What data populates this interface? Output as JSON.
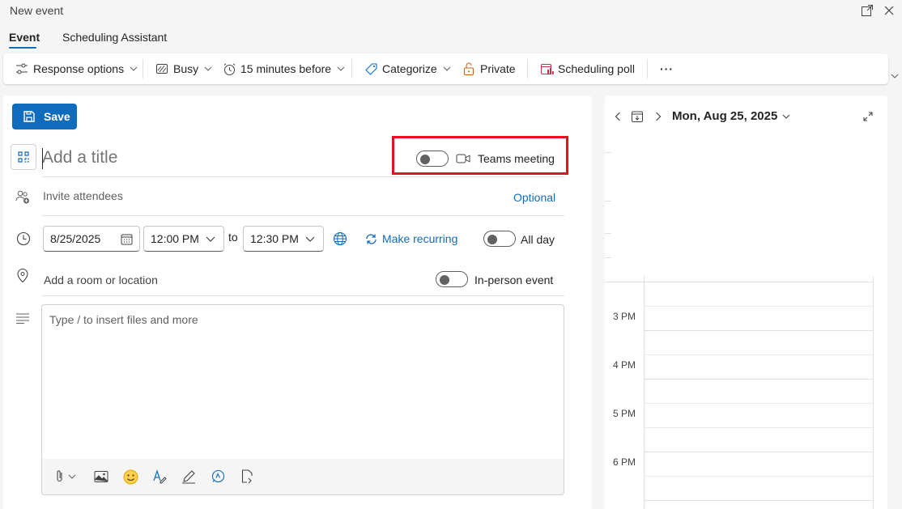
{
  "window": {
    "title": "New event",
    "popout_icon": "popout-icon",
    "close_icon": "close-icon"
  },
  "tabs": [
    {
      "label": "Event",
      "active": true
    },
    {
      "label": "Scheduling Assistant",
      "active": false
    }
  ],
  "ribbon": {
    "response_options": "Response options",
    "busy": "Busy",
    "reminder": "15 minutes before",
    "categorize": "Categorize",
    "private": "Private",
    "scheduling_poll": "Scheduling poll",
    "more": "···"
  },
  "form": {
    "save_label": "Save",
    "title_placeholder": "Add a title",
    "teams_label": "Teams meeting",
    "teams_enabled": false,
    "attendees_placeholder": "Invite attendees",
    "optional_label": "Optional",
    "start_date": "8/25/2025",
    "start_time": "12:00 PM",
    "to_label": "to",
    "end_time": "12:30 PM",
    "make_recurring": "Make recurring",
    "all_day_label": "All day",
    "all_day_enabled": false,
    "location_placeholder": "Add a room or location",
    "in_person_label": "In-person event",
    "in_person_enabled": false,
    "body_placeholder": "Type / to insert files and more"
  },
  "side_calendar": {
    "date_label": "Mon, Aug 25, 2025",
    "hours": [
      "3 PM",
      "4 PM",
      "5 PM",
      "6 PM"
    ]
  },
  "colors": {
    "accent": "#0f6cbd",
    "highlight_box": "#e3141f",
    "private_icon": "#c4651c",
    "poll_icon": "#c4314b",
    "emoji": "#eaa300"
  }
}
